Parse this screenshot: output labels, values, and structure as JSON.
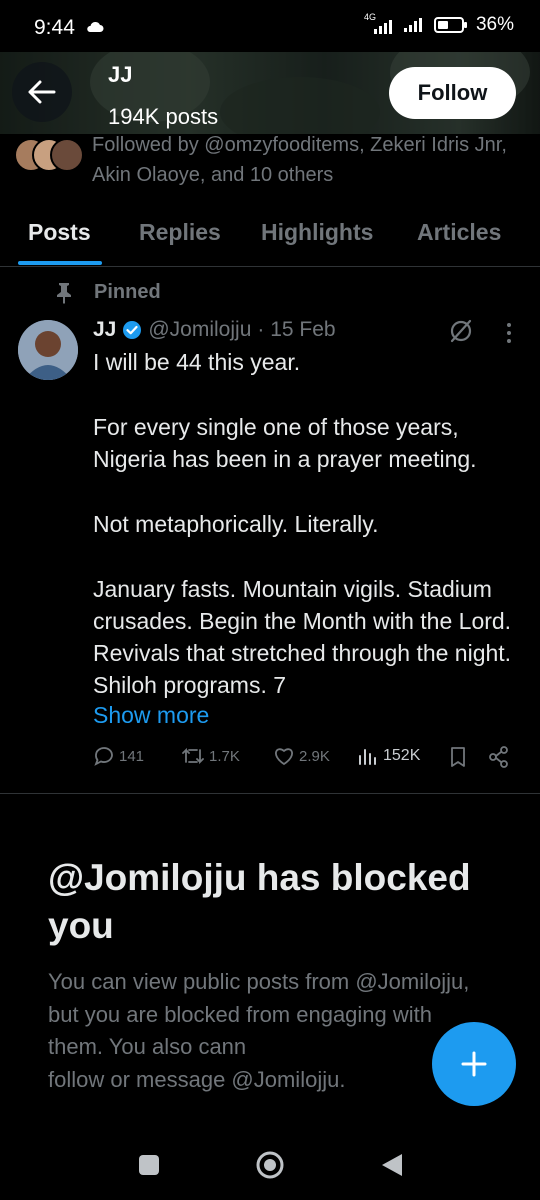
{
  "status": {
    "time": "9:44",
    "network": "4G",
    "battery": "36%"
  },
  "header": {
    "name": "JJ",
    "posts": "194K posts",
    "follow_label": "Follow"
  },
  "followed_by": "Followed by @omzyfooditems, Zekeri Idris Jnr, Akin Olaoye, and 10 others",
  "tabs": [
    "Posts",
    "Replies",
    "Highlights",
    "Articles"
  ],
  "post": {
    "pinned_label": "Pinned",
    "name": "JJ",
    "handle": "@Jomilojju",
    "date": "· 15 Feb",
    "paragraphs": [
      "I will be 44 this year.",
      "For every single one of those years, Nigeria has been in a prayer meeting.",
      "Not metaphorically. Literally.",
      "January fasts. Mountain vigils. Stadium crusades. Begin the Month with the Lord. Revivals that stretched through the night. Shiloh programs. 7"
    ],
    "show_more": "Show more",
    "replies": "141",
    "reposts": "1.7K",
    "likes": "2.9K",
    "views": "152K"
  },
  "blocked": {
    "title": "@Jomilojju has blocked you",
    "description": "You can view public posts from @Jomilojju, but you are blocked from engaging with them. You also cann",
    "description_end": "follow or message @Jomilojju."
  },
  "colors": {
    "accent": "#1d9bf0",
    "background": "#000000",
    "muted": "#71767b",
    "text": "#e7e9ea"
  },
  "icons": [
    "back-arrow-icon",
    "pin-icon",
    "verified-badge-icon",
    "grok-icon",
    "more-icon",
    "reply-icon",
    "repost-icon",
    "like-icon",
    "views-icon",
    "bookmark-icon",
    "share-icon",
    "compose-plus-icon"
  ]
}
